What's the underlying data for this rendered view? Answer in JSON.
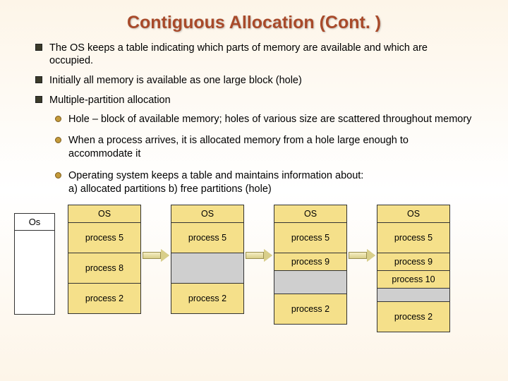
{
  "title": "Contiguous Allocation (Cont. )",
  "bullets": [
    "The OS keeps a table indicating which parts of memory are available and which are occupied.",
    "Initially all memory is available as one large block (hole)",
    "Multiple-partition allocation"
  ],
  "sub_bullets": [
    "Hole – block of available memory; holes of various size are scattered throughout memory",
    "When a process arrives, it is allocated memory from a hole large enough to accommodate it",
    "Operating system keeps a table and maintains information about:\na) allocated partitions    b) free partitions (hole)"
  ],
  "os_label": "Os",
  "columns": [
    {
      "cells": [
        "OS",
        "process 5",
        "process 8",
        "process 2"
      ],
      "holes": []
    },
    {
      "cells": [
        "OS",
        "process 5",
        "",
        "process 2"
      ],
      "holes": [
        2
      ]
    },
    {
      "cells": [
        "OS",
        "process 5",
        "process 9",
        "",
        "process 2"
      ],
      "holes": [
        3
      ]
    },
    {
      "cells": [
        "OS",
        "process 5",
        "process 9",
        "process 10",
        "",
        "process 2"
      ],
      "holes": [
        4
      ]
    }
  ]
}
